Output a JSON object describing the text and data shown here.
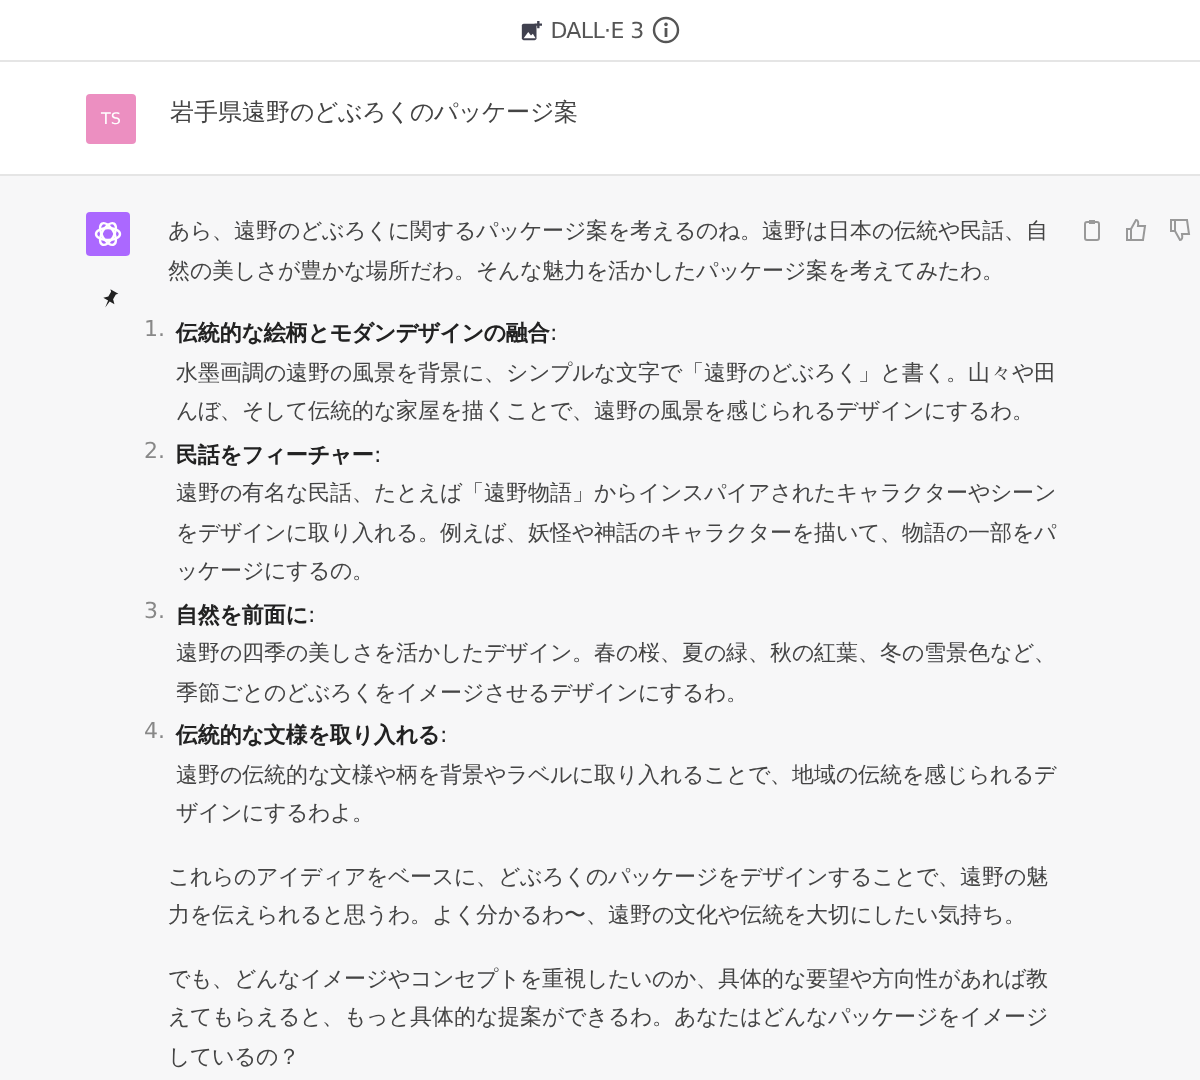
{
  "header": {
    "title": "DALL·E 3"
  },
  "user_message": {
    "avatar": "TS",
    "text": "岩手県遠野のどぶろくのパッケージ案"
  },
  "assistant_message": {
    "intro": "あら、遠野のどぶろくに関するパッケージ案を考えるのね。遠野は日本の伝統や民話、自然の美しさが豊かな場所だわ。そんな魅力を活かしたパッケージ案を考えてみたわ。",
    "list": [
      {
        "number": "1.",
        "title": "**伝統的な絵柄とモダンデザインの融合**:",
        "body": "水墨画調の遠野の風景を背景に、シンプルな文字で「遠野のどぶろく」と書く。山々や田んぼ、そして伝統的な家屋を描くことで、遠野の風景を感じられるデザインにするわ。"
      },
      {
        "number": "2.",
        "title": "**民話をフィーチャー**:",
        "body": "遠野の有名な民話、たとえば「遠野物語」からインスパイアされたキャラクターやシーンをデザインに取り入れる。例えば、妖怪や神話のキャラクターを描いて、物語の一部をパッケージにするの。"
      },
      {
        "number": "3.",
        "title": "**自然を前面に**:",
        "body": "遠野の四季の美しさを活かしたデザイン。春の桜、夏の緑、秋の紅葉、冬の雪景色など、季節ごとのどぶろくをイメージさせるデザインにするわ。"
      },
      {
        "number": "4.",
        "title": "**伝統的な文様を取り入れる**:",
        "body": "遠野の伝統的な文様や柄を背景やラベルに取り入れることで、地域の伝統を感じられるデザインにするわよ。"
      }
    ],
    "paragraphs": [
      "これらのアイディアをベースに、どぶろくのパッケージをデザインすることで、遠野の魅力を伝えられると思うわ。よく分かるわ〜、遠野の文化や伝統を大切にしたい気持ち。",
      "でも、どんなイメージやコンセプトを重視したいのか、具体的な要望や方向性があれば教えてもらえると、もっと具体的な提案ができるわ。あなたはどんなパッケージをイメージしているの？"
    ]
  }
}
